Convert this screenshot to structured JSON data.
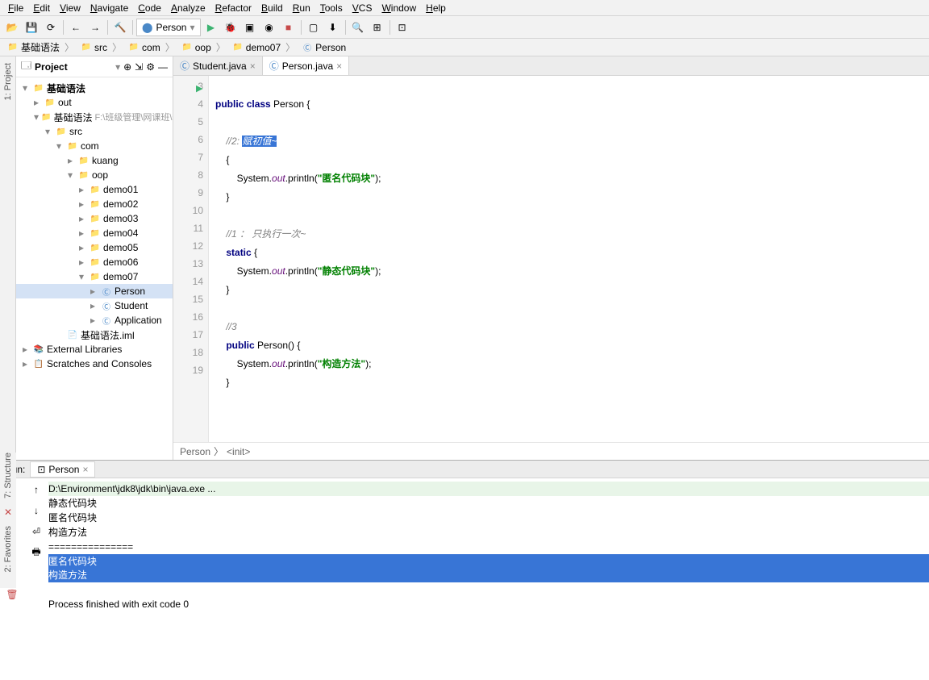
{
  "menu": [
    "File",
    "Edit",
    "View",
    "Navigate",
    "Code",
    "Analyze",
    "Refactor",
    "Build",
    "Run",
    "Tools",
    "VCS",
    "Window",
    "Help"
  ],
  "runConfig": "Person",
  "breadcrumbs": [
    {
      "icon": "folder",
      "label": "基础语法",
      "color": "c-blue"
    },
    {
      "icon": "folder",
      "label": "src",
      "color": "c-blue"
    },
    {
      "icon": "folder",
      "label": "com",
      "color": "c-grey"
    },
    {
      "icon": "folder",
      "label": "oop",
      "color": "c-grey"
    },
    {
      "icon": "folder",
      "label": "demo07",
      "color": "c-grey"
    },
    {
      "icon": "class",
      "label": "Person",
      "color": "c-blue"
    }
  ],
  "projectHeader": {
    "title": "Project"
  },
  "tree": [
    {
      "pad": 8,
      "exp": "▾",
      "ico": "📁",
      "lbl": "基础语法",
      "bold": true,
      "c": "c-blue"
    },
    {
      "pad": 22,
      "exp": "▸",
      "ico": "📁",
      "lbl": "out",
      "c": "c-orange"
    },
    {
      "pad": 22,
      "exp": "▾",
      "ico": "📁",
      "lbl": "基础语法",
      "suf": " F:\\班级管理\\网课班\\代码\\Ja",
      "c": "c-blue"
    },
    {
      "pad": 36,
      "exp": "▾",
      "ico": "📁",
      "lbl": "src",
      "c": "c-blue"
    },
    {
      "pad": 50,
      "exp": "▾",
      "ico": "📁",
      "lbl": "com",
      "c": "c-grey"
    },
    {
      "pad": 64,
      "exp": "▸",
      "ico": "📁",
      "lbl": "kuang",
      "c": "c-grey"
    },
    {
      "pad": 64,
      "exp": "▾",
      "ico": "📁",
      "lbl": "oop",
      "c": "c-grey"
    },
    {
      "pad": 78,
      "exp": "▸",
      "ico": "📁",
      "lbl": "demo01",
      "c": "c-grey"
    },
    {
      "pad": 78,
      "exp": "▸",
      "ico": "📁",
      "lbl": "demo02",
      "c": "c-grey"
    },
    {
      "pad": 78,
      "exp": "▸",
      "ico": "📁",
      "lbl": "demo03",
      "c": "c-grey"
    },
    {
      "pad": 78,
      "exp": "▸",
      "ico": "📁",
      "lbl": "demo04",
      "c": "c-grey"
    },
    {
      "pad": 78,
      "exp": "▸",
      "ico": "📁",
      "lbl": "demo05",
      "c": "c-grey"
    },
    {
      "pad": 78,
      "exp": "▸",
      "ico": "📁",
      "lbl": "demo06",
      "c": "c-grey"
    },
    {
      "pad": 78,
      "exp": "▾",
      "ico": "📁",
      "lbl": "demo07",
      "c": "c-grey"
    },
    {
      "pad": 92,
      "exp": "▸",
      "ico": "Ⓒ",
      "lbl": "Person",
      "sel": true,
      "c": "c-blue"
    },
    {
      "pad": 92,
      "exp": "▸",
      "ico": "Ⓒ",
      "lbl": "Student",
      "c": "c-blue"
    },
    {
      "pad": 92,
      "exp": "▸",
      "ico": "Ⓒ",
      "lbl": "Application",
      "c": "c-blue"
    },
    {
      "pad": 50,
      "exp": "",
      "ico": "📄",
      "lbl": "基础语法.iml",
      "c": "c-grey"
    },
    {
      "pad": 8,
      "exp": "▸",
      "ico": "📚",
      "lbl": "External Libraries"
    },
    {
      "pad": 8,
      "exp": "▸",
      "ico": "📋",
      "lbl": "Scratches and Consoles"
    }
  ],
  "tabs": [
    {
      "label": "Student.java",
      "active": false
    },
    {
      "label": "Person.java",
      "active": true
    }
  ],
  "code": {
    "lines": [
      "3",
      "4",
      "5",
      "6",
      "7",
      "8",
      "9",
      "10",
      "11",
      "12",
      "13",
      "14",
      "15",
      "16",
      "17",
      "18",
      "19"
    ],
    "l3_kw1": "public",
    "l3_kw2": "class",
    "l3_name": " Person {",
    "l5_cm": "//2: ",
    "l5_hl": "赋初值~",
    "l6": "{",
    "l7_a": "System.",
    "l7_f": "out",
    "l7_b": ".println(",
    "l7_s": "\"匿名代码块\"",
    "l7_c": ");",
    "l8": "}",
    "l10_cm": "//1 ： 只执行一次~",
    "l11_kw": "static",
    "l11_b": " {",
    "l12_a": "System.",
    "l12_f": "out",
    "l12_b": ".println(",
    "l12_s": "\"静态代码块\"",
    "l12_c": ");",
    "l13": "}",
    "l15_cm": "//3",
    "l16_kw": "public",
    "l16_b": " Person() {",
    "l17_a": "System.",
    "l17_f": "out",
    "l17_b": ".println(",
    "l17_s": "\"构造方法\"",
    "l17_c": ");",
    "l18": "}"
  },
  "editorBreadcrumb": [
    "Person",
    "<init>"
  ],
  "runHeader": {
    "label": "Run:",
    "tab": "Person"
  },
  "console": {
    "cmd": "D:\\Environment\\jdk8\\jdk\\bin\\java.exe ...",
    "l1": "静态代码块",
    "l2": "匿名代码块",
    "l3": "构造方法",
    "l4": "===============",
    "l5": "匿名代码块",
    "l6": "构造方法",
    "exit": "Process finished with exit code 0"
  },
  "sideTabs": {
    "project": "1: Project",
    "structure": "7: Structure",
    "favorites": "2: Favorites"
  }
}
